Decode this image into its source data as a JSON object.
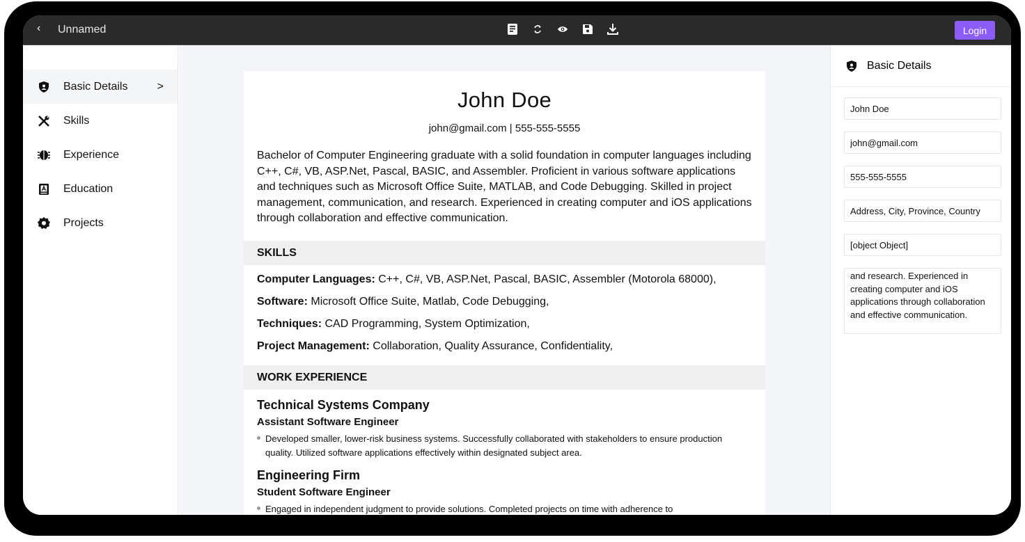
{
  "app": {
    "title": "Unnamed",
    "back_glyph": "‹",
    "login_label": "Login",
    "accent": "#8b5cf6"
  },
  "toolbar": {
    "icons": [
      "template-icon",
      "refresh-icon",
      "preview-icon",
      "save-icon",
      "download-icon"
    ]
  },
  "sidebar": {
    "items": [
      {
        "label": "Basic Details",
        "icon": "shield-icon",
        "active": true,
        "chevron": ">"
      },
      {
        "label": "Skills",
        "icon": "tools-icon"
      },
      {
        "label": "Experience",
        "icon": "brain-icon"
      },
      {
        "label": "Education",
        "icon": "book-icon"
      },
      {
        "label": "Projects",
        "icon": "badge-icon"
      }
    ]
  },
  "resume": {
    "name": "John Doe",
    "contact": "john@gmail.com | 555-555-5555",
    "summary": "Bachelor of Computer Engineering graduate with a solid foundation in computer languages including C++, C#, VB, ASP.Net, Pascal, BASIC, and Assembler. Proficient in various software applications and techniques such as Microsoft Office Suite, MATLAB, and Code Debugging. Skilled in project management, communication, and research. Experienced in creating computer and iOS applications through collaboration and effective communication.",
    "skills_heading": "SKILLS",
    "skills": [
      {
        "label": "Computer Languages:",
        "value": "C++, C#, VB, ASP.Net, Pascal, BASIC, Assembler (Motorola 68000),"
      },
      {
        "label": "Software:",
        "value": "Microsoft Office Suite, Matlab, Code Debugging,"
      },
      {
        "label": "Techniques:",
        "value": "CAD Programming, System Optimization,"
      },
      {
        "label": "Project Management:",
        "value": "Collaboration, Quality Assurance, Confidentiality,"
      }
    ],
    "experience_heading": "WORK EXPERIENCE",
    "experience": [
      {
        "company": "Technical Systems Company",
        "role": "Assistant Software Engineer",
        "bullet": "Developed smaller, lower-risk business systems. Successfully collaborated with stakeholders to ensure production quality. Utilized software applications effectively within designated subject area."
      },
      {
        "company": "Engineering Firm",
        "role": "Student Software Engineer",
        "bullet": "Engaged in independent judgment to provide solutions. Completed projects on time with adherence to"
      }
    ]
  },
  "form": {
    "heading": "Basic Details",
    "name": "John Doe",
    "email": "john@gmail.com",
    "phone": "555-555-5555",
    "address": "Address, City, Province, Country",
    "website": "[object Object]",
    "summary_visible": "and research. Experienced in creating computer and iOS applications through collaboration and effective communication."
  }
}
